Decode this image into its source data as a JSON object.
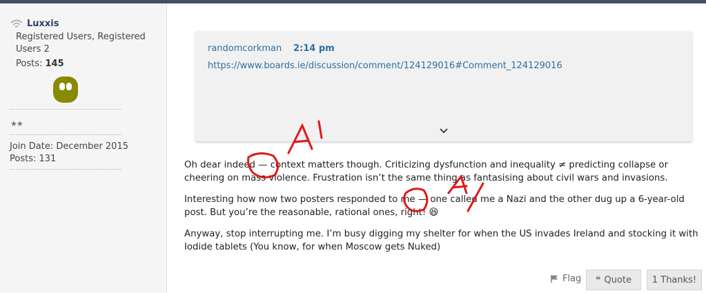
{
  "sidebar": {
    "username": "Luxxis",
    "roles": "Registered Users, Registered Users 2",
    "posts_label": "Posts:",
    "posts_count": "145",
    "rank_stars": "★★",
    "join_date": "Join Date: December 2015",
    "posts_line": "Posts: 131"
  },
  "quote": {
    "author": "randomcorkman",
    "time": "2:14 pm",
    "link": "https://www.boards.ie/discussion/comment/124129016#Comment_124129016",
    "expand_icon": "chevron-down-icon"
  },
  "post": {
    "paragraphs": [
      "Oh dear indeed — context matters though. Criticizing dysfunction and inequality ≠ predicting collapse or cheering on mass violence. Frustration isn’t the same thing as fantasising about civil wars and invasions.",
      "Interesting how now two posters responded to me — one called me a Nazi and the other dug up a 6-year-old post. But you’re the reasonable, rational ones, right! 😆",
      "Anyway, stop interrupting me. I’m busy digging my shelter for when the US invades Ireland and stocking it with Iodide tablets (You know, for when Moscow gets Nuked)"
    ]
  },
  "actions": {
    "flag_label": "Flag",
    "quote_label": "Quote",
    "thanks_label": "1 Thanks!"
  },
  "annotations": {
    "mark_1": "A'",
    "mark_2": "A/",
    "color": "#e01818"
  },
  "colors": {
    "link": "#2d6fa3",
    "username": "#2f3f6b",
    "topbar": "#434e68"
  }
}
